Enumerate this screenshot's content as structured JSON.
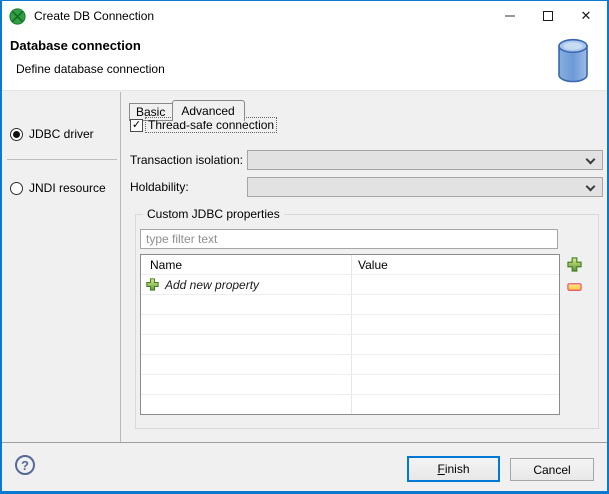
{
  "window": {
    "title": "Create DB Connection",
    "minimize_glyph": "–",
    "close_glyph": "✕"
  },
  "header": {
    "title": "Database connection",
    "subtitle": "Define database connection"
  },
  "sidebar": {
    "options": [
      {
        "label": "JDBC driver",
        "selected": true
      },
      {
        "label": "JNDI resource",
        "selected": false
      }
    ]
  },
  "tabs": {
    "basic": "Basic",
    "advanced": "Advanced",
    "active": "Advanced"
  },
  "advanced_tab": {
    "thread_safe_label": "Thread-safe connection",
    "thread_safe_checked": true,
    "check_glyph": "✓",
    "transaction_isolation_label": "Transaction isolation:",
    "transaction_isolation_value": "",
    "holdability_label": "Holdability:",
    "holdability_value": "",
    "group_title": "Custom JDBC properties",
    "filter_placeholder": "type filter text",
    "table": {
      "columns": [
        "Name",
        "Value"
      ],
      "add_row_label": "Add new property",
      "empty_row_count": 6
    }
  },
  "footer": {
    "help_glyph": "?",
    "finish_mnemonic": "F",
    "finish_rest": "inish",
    "cancel_label": "Cancel"
  },
  "colors": {
    "window_border": "#0b79d0",
    "titlebar_bg": "#ffffff",
    "content_bg": "#f0f0f0",
    "logo_green": "#2fa143",
    "db_icon_blue": "#5d8cce",
    "default_button_border": "#0078d7",
    "add_icon_green": "#67a33c",
    "remove_icon_red": "#ef5d6f"
  }
}
